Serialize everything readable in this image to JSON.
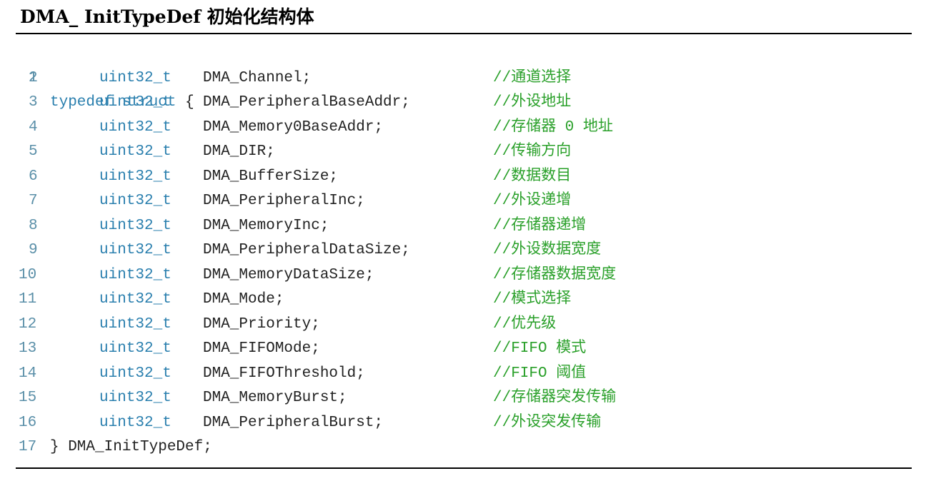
{
  "title": "DMA_ InitTypeDef 初始化结构体",
  "code": {
    "open_line": {
      "number": "1",
      "keyword1": "typedef",
      "keyword2": "struct",
      "brace": "{"
    },
    "fields": [
      {
        "number": "2",
        "type": "uint32_t",
        "name": "DMA_Channel;",
        "comment": "//通道选择"
      },
      {
        "number": "3",
        "type": "uint32_t",
        "name": "DMA_PeripheralBaseAddr;",
        "comment": "//外设地址"
      },
      {
        "number": "4",
        "type": "uint32_t",
        "name": "DMA_Memory0BaseAddr;",
        "comment": "//存储器 0 地址"
      },
      {
        "number": "5",
        "type": "uint32_t",
        "name": "DMA_DIR;",
        "comment": "//传输方向"
      },
      {
        "number": "6",
        "type": "uint32_t",
        "name": "DMA_BufferSize;",
        "comment": "//数据数目"
      },
      {
        "number": "7",
        "type": "uint32_t",
        "name": "DMA_PeripheralInc;",
        "comment": "//外设递增"
      },
      {
        "number": "8",
        "type": "uint32_t",
        "name": "DMA_MemoryInc;",
        "comment": "//存储器递增"
      },
      {
        "number": "9",
        "type": "uint32_t",
        "name": "DMA_PeripheralDataSize;",
        "comment": "//外设数据宽度"
      },
      {
        "number": "10",
        "type": "uint32_t",
        "name": "DMA_MemoryDataSize;",
        "comment": "//存储器数据宽度"
      },
      {
        "number": "11",
        "type": "uint32_t",
        "name": "DMA_Mode;",
        "comment": "//模式选择"
      },
      {
        "number": "12",
        "type": "uint32_t",
        "name": "DMA_Priority;",
        "comment": "//优先级"
      },
      {
        "number": "13",
        "type": "uint32_t",
        "name": "DMA_FIFOMode;",
        "comment": "//FIFO 模式"
      },
      {
        "number": "14",
        "type": "uint32_t",
        "name": "DMA_FIFOThreshold;",
        "comment": "//FIFO 阈值"
      },
      {
        "number": "15",
        "type": "uint32_t",
        "name": "DMA_MemoryBurst;",
        "comment": "//存储器突发传输"
      },
      {
        "number": "16",
        "type": "uint32_t",
        "name": "DMA_PeripheralBurst;",
        "comment": "//外设突发传输"
      }
    ],
    "close_line": {
      "number": "17",
      "text": "} DMA_InitTypeDef;"
    }
  }
}
